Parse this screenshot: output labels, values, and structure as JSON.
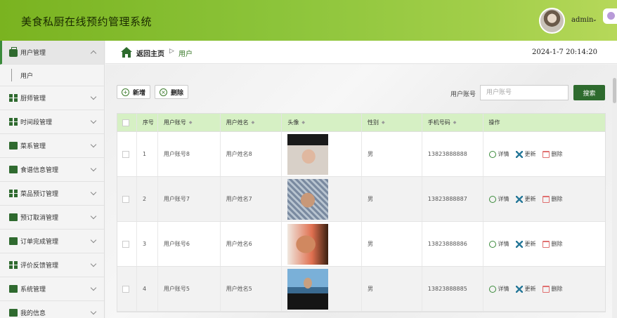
{
  "app": {
    "title": "美食私厨在线预约管理系统"
  },
  "user": {
    "name": "admin"
  },
  "breadcrumb": {
    "home": "返回主页",
    "separator": "▷",
    "current": "用户"
  },
  "datetime": "2024-1-7 20:14:20",
  "sidebar": {
    "items": [
      {
        "label": "用户管理",
        "active": true,
        "expanded": true
      },
      {
        "label": "厨师管理"
      },
      {
        "label": "时间段管理"
      },
      {
        "label": "菜系管理"
      },
      {
        "label": "食谱信息管理"
      },
      {
        "label": "菜品预订管理"
      },
      {
        "label": "预订取消管理"
      },
      {
        "label": "订单完成管理"
      },
      {
        "label": "评价反馈管理"
      },
      {
        "label": "系统管理"
      },
      {
        "label": "我的信息"
      }
    ],
    "sub_items": [
      {
        "label": "用户"
      }
    ]
  },
  "toolbar": {
    "add_label": "新增",
    "delete_label": "删除"
  },
  "search": {
    "label": "用户账号",
    "placeholder": "用户账号",
    "button": "搜索"
  },
  "table": {
    "headers": [
      "序号",
      "用户账号",
      "用户姓名",
      "头像",
      "性别",
      "手机号码",
      "操作"
    ],
    "rows": [
      {
        "index": "1",
        "account": "用户账号8",
        "name": "用户姓名8",
        "gender": "男",
        "phone": "13823888888"
      },
      {
        "index": "2",
        "account": "用户账号7",
        "name": "用户姓名7",
        "gender": "男",
        "phone": "13823888887"
      },
      {
        "index": "3",
        "account": "用户账号6",
        "name": "用户姓名6",
        "gender": "男",
        "phone": "13823888886"
      },
      {
        "index": "4",
        "account": "用户账号5",
        "name": "用户姓名5",
        "gender": "男",
        "phone": "13823888885"
      }
    ],
    "actions": {
      "detail": "详情",
      "update": "更新",
      "delete": "删除"
    }
  },
  "colors": {
    "header_green": "#8cc43a",
    "primary_green": "#2e6b2e",
    "table_header": "#d6f0c4"
  }
}
